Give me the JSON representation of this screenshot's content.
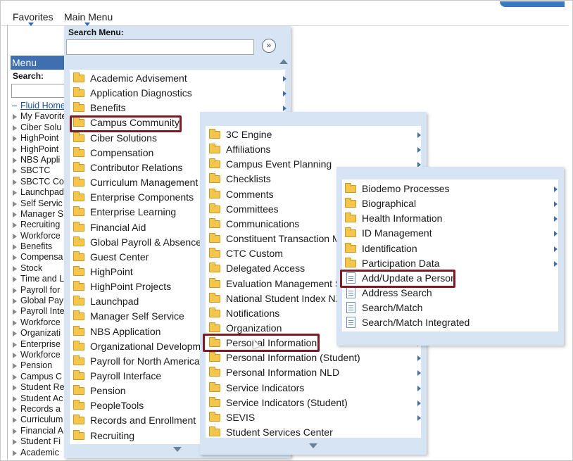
{
  "topbar": {
    "favorites_label": "Favorites",
    "main_menu_label": "Main Menu"
  },
  "left_pane": {
    "menu_title": "Menu",
    "search_label": "Search:",
    "items": [
      "Fluid Home",
      "My Favorites",
      "Ciber Solu",
      "HighPoint",
      "HighPoint",
      "NBS Appli",
      "SBCTC",
      "SBCTC Co",
      "Launchpad",
      "Self Servic",
      "Manager S",
      "Recruiting",
      "Workforce",
      "Benefits",
      "Compensa",
      "Stock",
      "Time and L",
      "Payroll for",
      "Global Pay",
      "Payroll Inte",
      "Workforce",
      "Organizati",
      "Enterprise",
      "Workforce",
      "Pension",
      "Campus C",
      "Student Re",
      "Student Ac",
      "Records a",
      "Curriculum",
      "Financial A",
      "Student Fi",
      "Academic"
    ]
  },
  "main_menu": {
    "search_label": "Search Menu:",
    "search_value": "",
    "go_icon": "double-chevron-right-icon",
    "items": [
      "Academic Advisement",
      "Application Diagnostics",
      "Benefits",
      "Campus Community",
      "Ciber Solutions",
      "Compensation",
      "Contributor Relations",
      "Curriculum Management",
      "Enterprise Components",
      "Enterprise Learning",
      "Financial Aid",
      "Global Payroll & Absence Mgmt",
      "Guest Center",
      "HighPoint",
      "HighPoint Projects",
      "Launchpad",
      "Manager Self Service",
      "NBS Application",
      "Organizational Development",
      "Payroll for North America",
      "Payroll Interface",
      "Pension",
      "PeopleTools",
      "Records and Enrollment",
      "Recruiting"
    ],
    "selected": "Campus Community"
  },
  "campus_menu": {
    "items": [
      "3C Engine",
      "Affiliations",
      "Campus Event Planning",
      "Checklists",
      "Comments",
      "Committees",
      "Communications",
      "Constituent Transaction Mgmt",
      "CTC Custom",
      "Delegated Access",
      "Evaluation Management System",
      "National Student Index NZL",
      "Notifications",
      "Organization",
      "Personal Information",
      "Personal Information (Student)",
      "Personal Information NLD",
      "Service Indicators",
      "Service Indicators (Student)",
      "SEVIS",
      "Student Services Center"
    ],
    "selected": "Personal Information"
  },
  "personal_menu": {
    "items": [
      "Biodemo Processes",
      "Biographical",
      "Health Information",
      "ID Management",
      "Identification",
      "Participation Data",
      "Add/Update a Person",
      "Address Search",
      "Search/Match",
      "Search/Match Integrated"
    ],
    "selected": "Add/Update a Person"
  },
  "colors": {
    "highlight_border": "#7d1a23",
    "panel_frame": "#d7e4f3",
    "menu_header": "#3f6fb0",
    "folder": "#f4c64d"
  }
}
